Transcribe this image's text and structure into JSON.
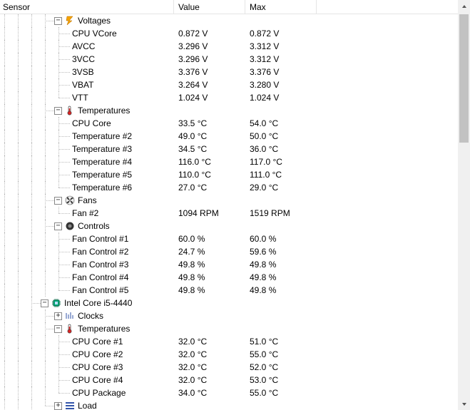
{
  "columns": {
    "sensor": "Sensor",
    "value": "Value",
    "max": "Max"
  },
  "groups": [
    {
      "level": 3,
      "expanded": true,
      "icon": "bolt-icon",
      "label": "Voltages",
      "rows": [
        {
          "label": "CPU VCore",
          "value": "0.872 V",
          "max": "0.872 V"
        },
        {
          "label": "AVCC",
          "value": "3.296 V",
          "max": "3.312 V"
        },
        {
          "label": "3VCC",
          "value": "3.296 V",
          "max": "3.312 V"
        },
        {
          "label": "3VSB",
          "value": "3.376 V",
          "max": "3.376 V"
        },
        {
          "label": "VBAT",
          "value": "3.264 V",
          "max": "3.280 V"
        },
        {
          "label": "VTT",
          "value": "1.024 V",
          "max": "1.024 V"
        }
      ]
    },
    {
      "level": 3,
      "expanded": true,
      "icon": "thermometer-icon",
      "label": "Temperatures",
      "rows": [
        {
          "label": "CPU Core",
          "value": "33.5 °C",
          "max": "54.0 °C"
        },
        {
          "label": "Temperature #2",
          "value": "49.0 °C",
          "max": "50.0 °C"
        },
        {
          "label": "Temperature #3",
          "value": "34.5 °C",
          "max": "36.0 °C"
        },
        {
          "label": "Temperature #4",
          "value": "116.0 °C",
          "max": "117.0 °C"
        },
        {
          "label": "Temperature #5",
          "value": "110.0 °C",
          "max": "111.0 °C"
        },
        {
          "label": "Temperature #6",
          "value": "27.0 °C",
          "max": "29.0 °C"
        }
      ]
    },
    {
      "level": 3,
      "expanded": true,
      "icon": "fan-icon",
      "label": "Fans",
      "rows": [
        {
          "label": "Fan #2",
          "value": "1094 RPM",
          "max": "1519 RPM"
        }
      ]
    },
    {
      "level": 3,
      "expanded": true,
      "icon": "control-icon",
      "label": "Controls",
      "rows": [
        {
          "label": "Fan Control #1",
          "value": "60.0 %",
          "max": "60.0 %"
        },
        {
          "label": "Fan Control #2",
          "value": "24.7 %",
          "max": "59.6 %"
        },
        {
          "label": "Fan Control #3",
          "value": "49.8 %",
          "max": "49.8 %"
        },
        {
          "label": "Fan Control #4",
          "value": "49.8 %",
          "max": "49.8 %"
        },
        {
          "label": "Fan Control #5",
          "value": "49.8 %",
          "max": "49.8 %"
        }
      ]
    }
  ],
  "cpu": {
    "level": 2,
    "expanded": true,
    "icon": "cpu-icon",
    "label": "Intel Core i5-4440",
    "children": [
      {
        "level": 3,
        "expanded": false,
        "icon": "clock-icon",
        "label": "Clocks",
        "rows": []
      },
      {
        "level": 3,
        "expanded": true,
        "icon": "thermometer-icon",
        "label": "Temperatures",
        "rows": [
          {
            "label": "CPU Core #1",
            "value": "32.0 °C",
            "max": "51.0 °C"
          },
          {
            "label": "CPU Core #2",
            "value": "32.0 °C",
            "max": "55.0 °C"
          },
          {
            "label": "CPU Core #3",
            "value": "32.0 °C",
            "max": "52.0 °C"
          },
          {
            "label": "CPU Core #4",
            "value": "32.0 °C",
            "max": "53.0 °C"
          },
          {
            "label": "CPU Package",
            "value": "34.0 °C",
            "max": "55.0 °C"
          }
        ]
      },
      {
        "level": 3,
        "expanded": false,
        "icon": "load-icon",
        "label": "Load",
        "rows": []
      }
    ]
  }
}
